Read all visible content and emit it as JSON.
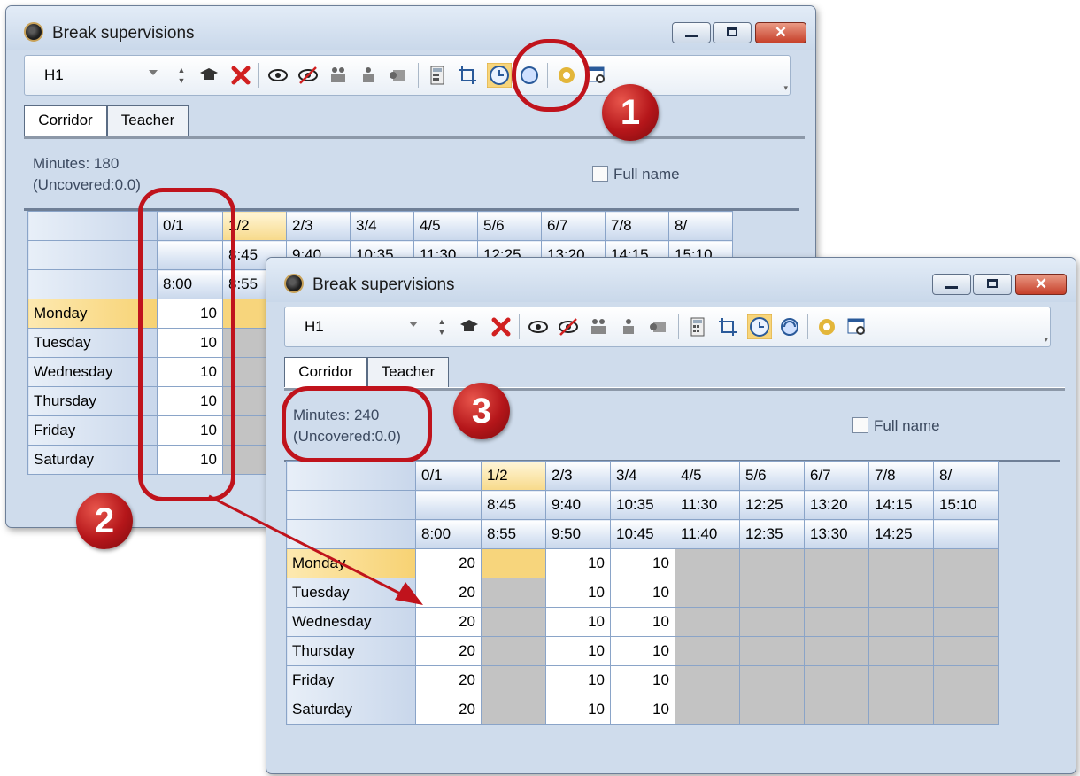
{
  "colors": {
    "accent_red": "#c0131c",
    "selection_yellow": "#f7d57c",
    "disabled_gray": "#c3c3c3"
  },
  "toolbar_icons": [
    "spin-icon",
    "graduation-cap-icon",
    "delete-icon",
    "eye-icon",
    "eye-crossed-icon",
    "teachers-assign-icon",
    "teachers-remove-icon",
    "bell-icon",
    "calculator-icon",
    "crop-icon",
    "clock-icon",
    "refresh-clock-icon",
    "gear-icon",
    "settings-window-icon"
  ],
  "window_back": {
    "title": "Break supervisions",
    "toolbar": {
      "selected": "H1"
    },
    "tabs": [
      "Corridor",
      "Teacher"
    ],
    "minutes_text": "Minutes: 180\n(Uncovered:0.0)",
    "full_name_label": "Full name",
    "columns": [
      "0/1",
      "1/2",
      "2/3",
      "3/4",
      "4/5",
      "5/6",
      "6/7",
      "7/8",
      "8/"
    ],
    "start_times": [
      "",
      "8:45",
      "9:40",
      "10:35",
      "11:30",
      "12:25",
      "13:20",
      "14:15",
      "15:10"
    ],
    "end_times": [
      "8:00",
      "8:55"
    ],
    "days": [
      "Monday",
      "Tuesday",
      "Wednesday",
      "Thursday",
      "Friday",
      "Saturday"
    ],
    "values": [
      "10",
      "10",
      "10",
      "10",
      "10",
      "10"
    ]
  },
  "window_front": {
    "title": "Break supervisions",
    "toolbar": {
      "selected": "H1"
    },
    "tabs": [
      "Corridor",
      "Teacher"
    ],
    "minutes_text": "Minutes: 240\n(Uncovered:0.0)",
    "full_name_label": "Full name",
    "columns": [
      "0/1",
      "1/2",
      "2/3",
      "3/4",
      "4/5",
      "5/6",
      "6/7",
      "7/8",
      "8/"
    ],
    "start_times": [
      "",
      "8:45",
      "9:40",
      "10:35",
      "11:30",
      "12:25",
      "13:20",
      "14:15",
      "15:10"
    ],
    "end_times": [
      "8:00",
      "8:55",
      "9:50",
      "10:45",
      "11:40",
      "12:35",
      "13:30",
      "14:25",
      ""
    ],
    "rows": [
      {
        "day": "Monday",
        "v01": "20",
        "v23": "10",
        "v34": "10"
      },
      {
        "day": "Tuesday",
        "v01": "20",
        "v23": "10",
        "v34": "10"
      },
      {
        "day": "Wednesday",
        "v01": "20",
        "v23": "10",
        "v34": "10"
      },
      {
        "day": "Thursday",
        "v01": "20",
        "v23": "10",
        "v34": "10"
      },
      {
        "day": "Friday",
        "v01": "20",
        "v23": "10",
        "v34": "10"
      },
      {
        "day": "Saturday",
        "v01": "20",
        "v23": "10",
        "v34": "10"
      }
    ]
  },
  "annotations": [
    "1",
    "2",
    "3"
  ]
}
